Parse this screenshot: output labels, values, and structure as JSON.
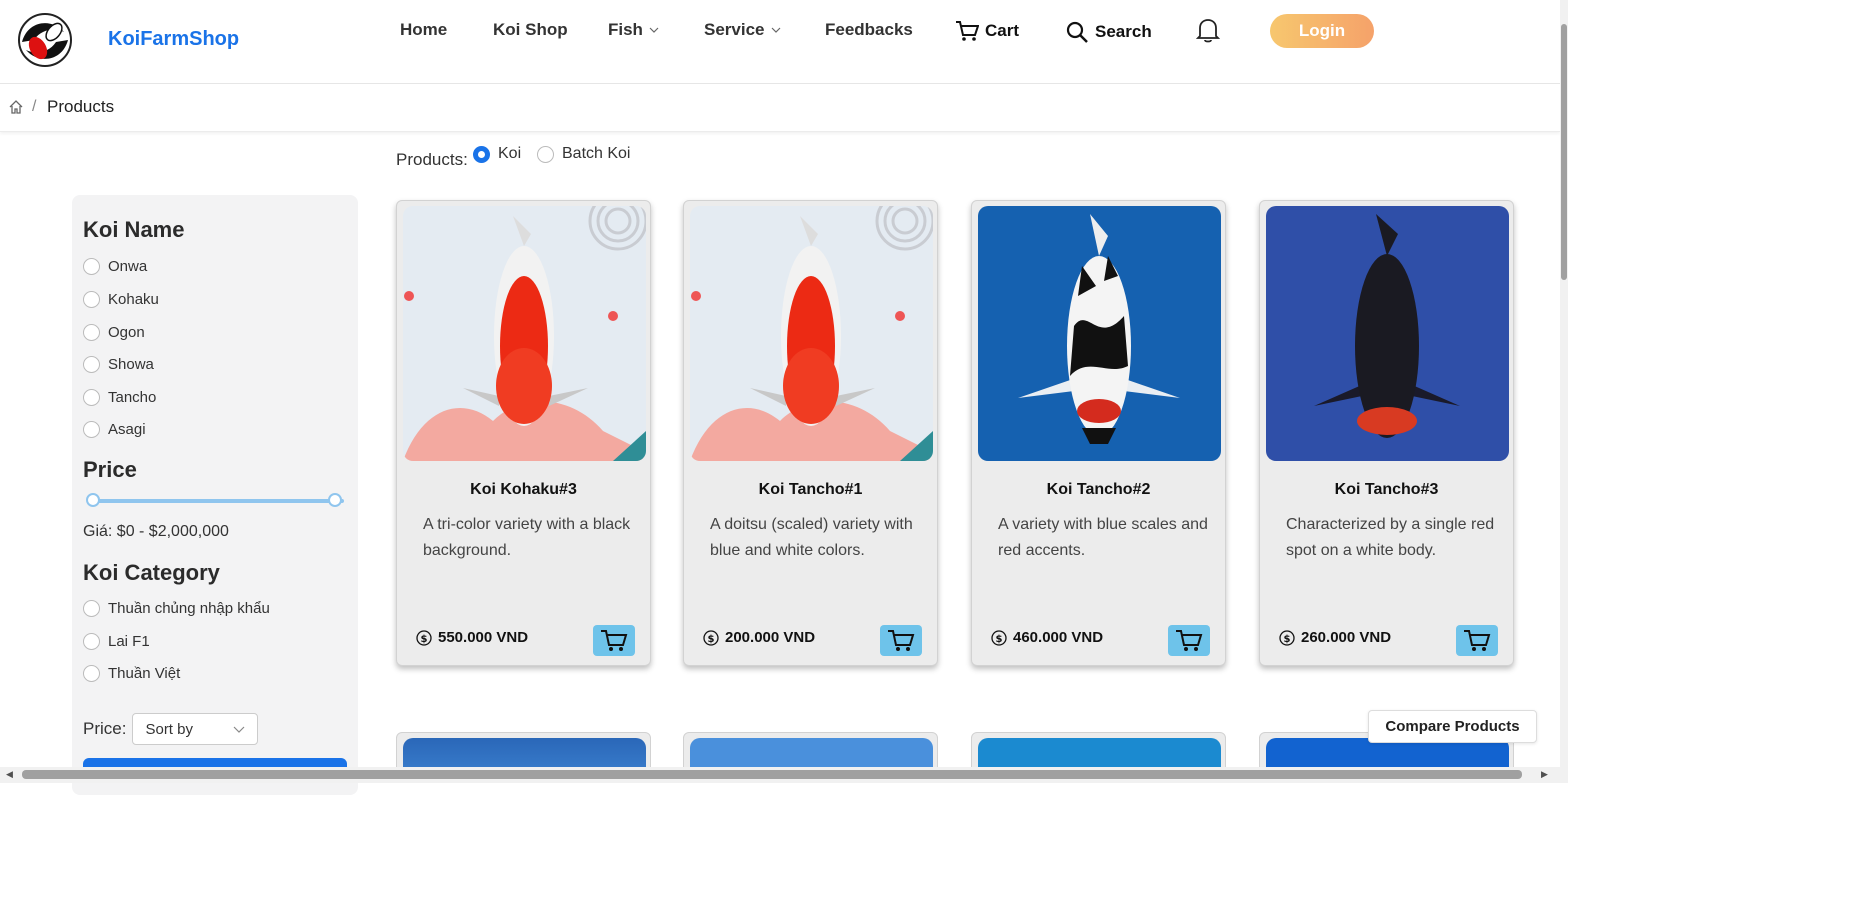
{
  "header": {
    "brand": "KoiFarmShop",
    "nav": [
      "Home",
      "Koi Shop",
      "Fish",
      "Service",
      "Feedbacks",
      "Cart",
      "Search"
    ],
    "login": "Login"
  },
  "breadcrumb": {
    "current": "Products",
    "separator": "/"
  },
  "product_type": {
    "label": "Products:",
    "options": [
      "Koi",
      "Batch Koi"
    ],
    "selected": "Koi"
  },
  "sidebar": {
    "koi_name_title": "Koi Name",
    "koi_names": [
      "Onwa",
      "Kohaku",
      "Ogon",
      "Showa",
      "Tancho",
      "Asagi"
    ],
    "price_title": "Price",
    "price_range_text": "Giá: $0 - $2,000,000",
    "price_min_fraction": 0,
    "price_max_fraction": 1,
    "category_title": "Koi Category",
    "categories": [
      "Thuần chủng nhập khẩu",
      "Lai F1",
      "Thuần Việt"
    ],
    "sort_label": "Price:",
    "sort_value": "Sort by"
  },
  "products": [
    {
      "name": "Koi Kohaku#3",
      "desc": "A tri-color variety with a black background.",
      "price": "550.000 VND"
    },
    {
      "name": "Koi Tancho#1",
      "desc": "A doitsu (scaled) variety with blue and white colors.",
      "price": "200.000 VND"
    },
    {
      "name": "Koi Tancho#2",
      "desc": "A variety with blue scales and red accents.",
      "price": "460.000 VND"
    },
    {
      "name": "Koi Tancho#3",
      "desc": "Characterized by a single red spot on a white body.",
      "price": "260.000 VND"
    }
  ],
  "compare_label": "Compare Products",
  "colors": {
    "brand": "#1a73e8",
    "login_from": "#f7c76e",
    "login_to": "#f5a26a",
    "cart_button": "#6ec3ea",
    "sidebar_bg": "#f3f3f4"
  }
}
